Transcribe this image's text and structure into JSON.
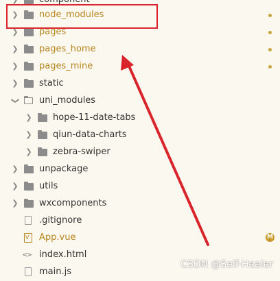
{
  "tree": {
    "top_partial": "component",
    "items": [
      {
        "label": "node_modules",
        "color": "orange",
        "marker": "dot"
      },
      {
        "label": "pages",
        "color": "orange",
        "marker": "dot"
      },
      {
        "label": "pages_home",
        "color": "orange",
        "marker": "dot"
      },
      {
        "label": "pages_mine",
        "color": "orange",
        "marker": "dot"
      },
      {
        "label": "static",
        "color": "dark",
        "marker": "none"
      },
      {
        "label": "uni_modules",
        "color": "dark",
        "marker": "none"
      },
      {
        "label": "hope-11-date-tabs",
        "color": "dark",
        "marker": "none"
      },
      {
        "label": "qiun-data-charts",
        "color": "dark",
        "marker": "none"
      },
      {
        "label": "zebra-swiper",
        "color": "dark",
        "marker": "none"
      },
      {
        "label": "unpackage",
        "color": "dark",
        "marker": "none"
      },
      {
        "label": "utils",
        "color": "dark",
        "marker": "none"
      },
      {
        "label": "wxcomponents",
        "color": "dark",
        "marker": "none"
      },
      {
        "label": ".gitignore",
        "color": "dark",
        "marker": "none"
      },
      {
        "label": "App.vue",
        "color": "orange",
        "marker": "badge",
        "badge": "M"
      },
      {
        "label": "index.html",
        "color": "dark",
        "marker": "none"
      },
      {
        "label": "main.js",
        "color": "dark",
        "marker": "none"
      }
    ]
  },
  "annotation": {
    "color": "#d9242c"
  },
  "watermark": "CSDN @Self-Healer",
  "colors": {
    "background": "#fbf8ef",
    "modified": "#b7851c",
    "text": "#333333"
  }
}
